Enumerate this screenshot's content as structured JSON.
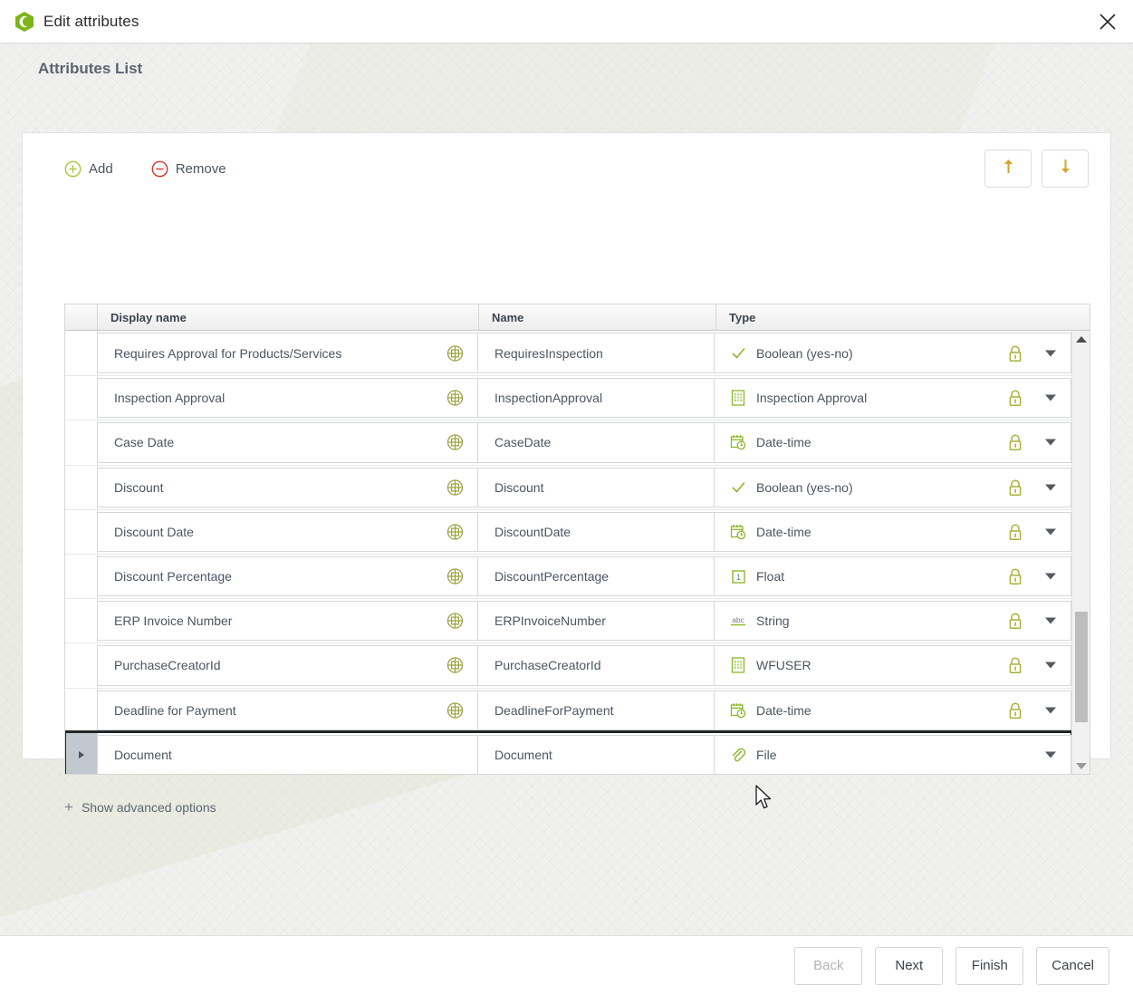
{
  "window": {
    "title": "Edit attributes",
    "logo_icon": "green-hexagon-logo",
    "close_icon": "close-icon"
  },
  "section": {
    "title": "Attributes List"
  },
  "toolbar": {
    "add_label": "Add",
    "add_icon": "circle-plus-icon",
    "remove_label": "Remove",
    "remove_icon": "circle-minus-icon",
    "move_up_icon": "arrow-up-icon",
    "move_down_icon": "arrow-down-icon",
    "accent_add": "#8cb82b",
    "accent_remove": "#d93025",
    "accent_arrow": "#d8a22a"
  },
  "table": {
    "headers": {
      "select": "",
      "display_name": "Display name",
      "name": "Name",
      "type": "Type"
    },
    "rows": [
      {
        "display_name": "Requires Approval for Products/Services",
        "name": "RequiresInspection",
        "type": "Boolean (yes-no)",
        "type_icon": "checkmark-icon",
        "locked": true,
        "localize_icon": "globe-icon",
        "selected": false
      },
      {
        "display_name": "Inspection Approval",
        "name": "InspectionApproval",
        "type": "Inspection Approval",
        "type_icon": "table-object-icon",
        "locked": true,
        "localize_icon": "globe-icon",
        "selected": false
      },
      {
        "display_name": "Case Date",
        "name": "CaseDate",
        "type": "Date-time",
        "type_icon": "calendar-clock-icon",
        "locked": true,
        "localize_icon": "globe-icon",
        "selected": false
      },
      {
        "display_name": "Discount",
        "name": "Discount",
        "type": "Boolean (yes-no)",
        "type_icon": "checkmark-icon",
        "locked": true,
        "localize_icon": "globe-icon",
        "selected": false
      },
      {
        "display_name": "Discount Date",
        "name": "DiscountDate",
        "type": "Date-time",
        "type_icon": "calendar-clock-icon",
        "locked": true,
        "localize_icon": "globe-icon",
        "selected": false
      },
      {
        "display_name": "Discount Percentage",
        "name": "DiscountPercentage",
        "type": "Float",
        "type_icon": "number-box-icon",
        "locked": true,
        "localize_icon": "globe-icon",
        "selected": false
      },
      {
        "display_name": "ERP Invoice Number",
        "name": "ERPInvoiceNumber",
        "type": "String",
        "type_icon": "abc-icon",
        "locked": true,
        "localize_icon": "globe-icon",
        "selected": false
      },
      {
        "display_name": "PurchaseCreatorId",
        "name": "PurchaseCreatorId",
        "type": "WFUSER",
        "type_icon": "table-object-icon",
        "locked": true,
        "localize_icon": "globe-icon",
        "selected": false
      },
      {
        "display_name": "Deadline for Payment",
        "name": "DeadlineForPayment",
        "type": "Date-time",
        "type_icon": "calendar-clock-icon",
        "locked": true,
        "localize_icon": "globe-icon",
        "selected": false
      },
      {
        "display_name": "Document",
        "name": "Document",
        "type": "File",
        "type_icon": "paperclip-icon",
        "locked": false,
        "localize_icon": "",
        "selected": true
      }
    ]
  },
  "advanced": {
    "label": "Show advanced options",
    "plus": "+"
  },
  "footer": {
    "back_label": "Back",
    "next_label": "Next",
    "finish_label": "Finish",
    "cancel_label": "Cancel",
    "back_disabled": true
  }
}
